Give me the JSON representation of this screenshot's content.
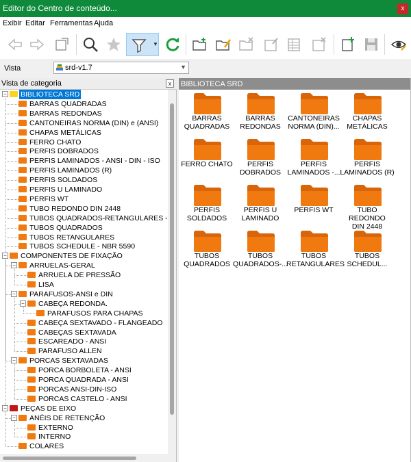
{
  "window": {
    "title": "Editor do Centro de conteúdo...",
    "close_glyph": "x"
  },
  "menu": [
    "Exibir",
    "Editar",
    "Ferramentas",
    "Ajuda"
  ],
  "toolbar": {
    "icons": [
      "arrow-left-icon",
      "arrow-right-icon",
      "place-icon",
      "search-icon",
      "star-icon",
      "filter-icon",
      "refresh-icon",
      "new-category-icon",
      "edit-category-icon",
      "delete-category-icon",
      "new-family-icon",
      "edit-family-icon",
      "delete-family-icon",
      "add-family-icon",
      "save-icon",
      "view-options-icon"
    ],
    "active": "filter-icon",
    "accent": "#0078d7"
  },
  "vista": {
    "label": "Vista",
    "selected": "srd-v1.7"
  },
  "left_panel": {
    "title": "Vista de categoria",
    "close_glyph": "x",
    "tree": [
      {
        "label": "BIBLIOTECA SRD",
        "level": 0,
        "toggle": "−",
        "icon": "yellow",
        "selected": true
      },
      {
        "label": "BARRAS QUADRADAS",
        "level": 1
      },
      {
        "label": "BARRAS REDONDAS",
        "level": 1
      },
      {
        "label": "CANTONEIRAS NORMA (DIN) e (ANSI)",
        "level": 1
      },
      {
        "label": "CHAPAS METÁLICAS",
        "level": 1
      },
      {
        "label": "FERRO CHATO",
        "level": 1
      },
      {
        "label": "PERFIS DOBRADOS",
        "level": 1
      },
      {
        "label": "PERFIS LAMINADOS - ANSI - DIN - ISO",
        "level": 1
      },
      {
        "label": "PERFIS LAMINADOS (R)",
        "level": 1
      },
      {
        "label": "PERFIS SOLDADOS",
        "level": 1
      },
      {
        "label": "PERFIS U LAMINADO",
        "level": 1
      },
      {
        "label": "PERFIS WT",
        "level": 1
      },
      {
        "label": "TUBO REDONDO DIN 2448",
        "level": 1
      },
      {
        "label": "TUBOS QUADRADOS-RETANGULARES - ISO - A",
        "level": 1
      },
      {
        "label": "TUBOS QUADRADOS",
        "level": 1
      },
      {
        "label": "TUBOS RETANGULARES",
        "level": 1
      },
      {
        "label": "TUBOS SCHEDULE - NBR 5590",
        "level": 1
      },
      {
        "label": "COMPONENTES DE FIXAÇÃO",
        "level": 0,
        "toggle": "−"
      },
      {
        "label": "ARRUELAS-GERAL",
        "level": 1,
        "toggle": "−"
      },
      {
        "label": "ARRUELA DE PRESSÃO",
        "level": 2
      },
      {
        "label": "LISA",
        "level": 2
      },
      {
        "label": "PARAFUSOS-ANSI e DIN",
        "level": 1,
        "toggle": "−"
      },
      {
        "label": "CABEÇA REDONDA.",
        "level": 2,
        "toggle": "−"
      },
      {
        "label": "PARAFUSOS PARA CHAPAS",
        "level": 3
      },
      {
        "label": "CABEÇA SEXTAVADO - FLANGEADO",
        "level": 2
      },
      {
        "label": "CABEÇAS SEXTAVADA",
        "level": 2
      },
      {
        "label": "ESCAREADO - ANSI",
        "level": 2
      },
      {
        "label": "PARAFUSO ALLEN",
        "level": 2
      },
      {
        "label": "PORCAS SEXTAVADAS",
        "level": 1,
        "toggle": "−"
      },
      {
        "label": "PORCA BORBOLETA - ANSI",
        "level": 2
      },
      {
        "label": "PORCA QUADRADA - ANSI",
        "level": 2
      },
      {
        "label": "PORCAS ANSI-DIN-ISO",
        "level": 2
      },
      {
        "label": "PORCAS CASTELO - ANSI",
        "level": 2
      },
      {
        "label": "PEÇAS DE EIXO",
        "level": 0,
        "toggle": "−",
        "icon": "red"
      },
      {
        "label": "ANÉIS DE RETENÇÃO",
        "level": 1,
        "toggle": "−"
      },
      {
        "label": "EXTERNO",
        "level": 2
      },
      {
        "label": "INTERNO",
        "level": 2
      },
      {
        "label": "COLARES",
        "level": 1
      }
    ]
  },
  "right_panel": {
    "title": "BIBLIOTECA SRD",
    "folder_color": "#f07a10",
    "tiles": [
      "BARRAS\nQUADRADAS",
      "BARRAS\nREDONDAS",
      "CANTONEIRAS\nNORMA (DIN)...",
      "CHAPAS\nMETÁLICAS",
      "FERRO CHATO",
      "PERFIS\nDOBRADOS",
      "PERFIS\nLAMINADOS -...",
      "PERFIS\nLAMINADOS (R)",
      "PERFIS\nSOLDADOS",
      "PERFIS U\nLAMINADO",
      "PERFIS WT",
      "TUBO REDONDO\nDIN 2448",
      "TUBOS\nQUADRADOS",
      "TUBOS\nQUADRADOS-...",
      "TUBOS\nRETANGULARES",
      "TUBOS\nSCHEDUL..."
    ]
  }
}
